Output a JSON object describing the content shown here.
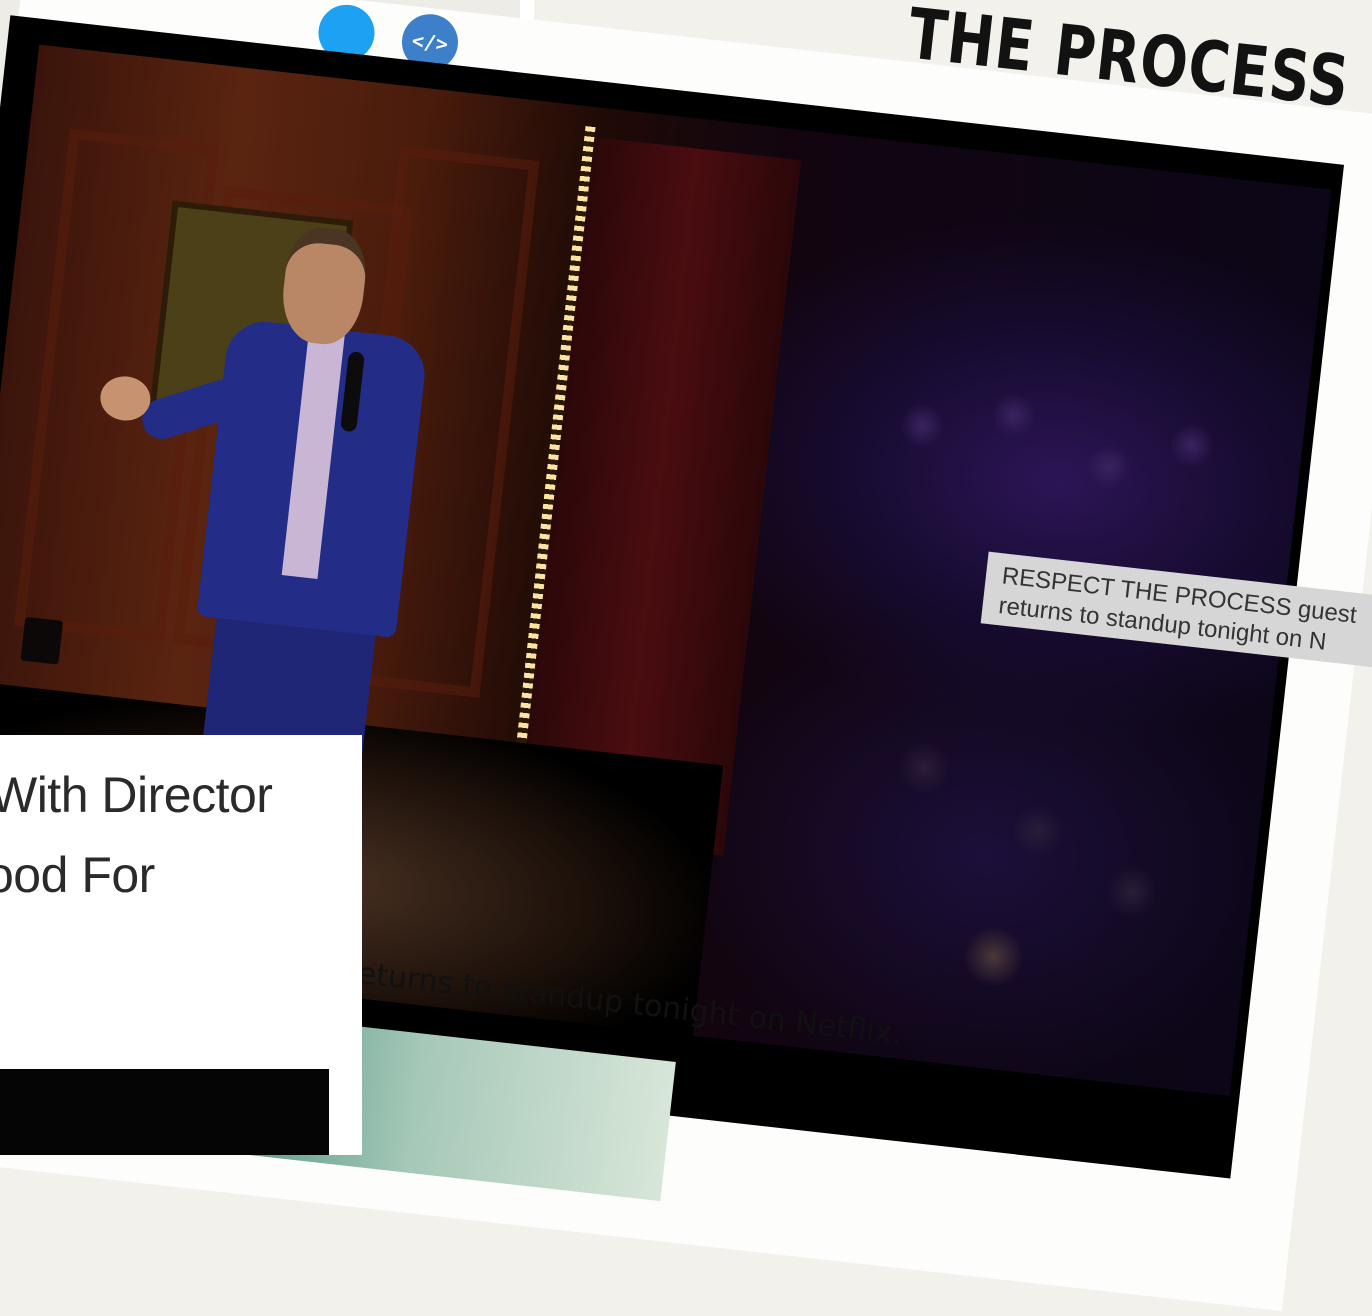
{
  "site": {
    "title": "THE PROCESS"
  },
  "share_icons": [
    {
      "name": "twitter-icon",
      "glyph": ""
    },
    {
      "name": "embed-icon",
      "glyph": "</>"
    }
  ],
  "article": {
    "title_line_1": "With Director",
    "title_line_2": "ood For"
  },
  "photo": {
    "overlay_caption_line_1": "RESPECT THE PROCESS guest",
    "overlay_caption_line_2": "returns to standup tonight on N",
    "caption": "atow returns to standup tonight on Netflix."
  },
  "colors": {
    "twitter": "#1da1f2",
    "embed": "#3d7fc9",
    "caption_box": "#d6d6d6"
  }
}
